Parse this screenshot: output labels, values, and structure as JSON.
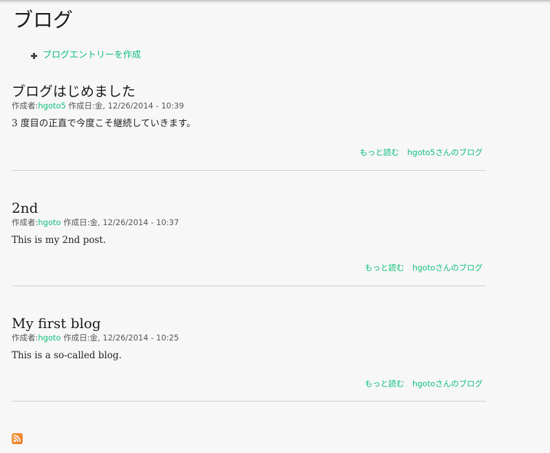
{
  "page": {
    "title": "ブログ"
  },
  "actions": {
    "create_entry": "ブログエントリーを作成"
  },
  "posts": [
    {
      "title": "ブログはじめました",
      "meta_prefix": "作成者:",
      "author": "hgoto5",
      "meta_date": " 作成日:金, 12/26/2014 - 10:39",
      "body": "3 度目の正直で今度こそ継続していきます。",
      "read_more": "もっと読む",
      "author_blog": "hgoto5さんのブログ"
    },
    {
      "title": "2nd",
      "meta_prefix": "作成者:",
      "author": "hgoto",
      "meta_date": " 作成日:金, 12/26/2014 - 10:37",
      "body": "This is my 2nd post.",
      "read_more": "もっと読む",
      "author_blog": "hgotoさんのブログ"
    },
    {
      "title": "My first blog",
      "meta_prefix": "作成者:",
      "author": "hgoto",
      "meta_date": " 作成日:金, 12/26/2014 - 10:25",
      "body": "This is a so-called blog.",
      "read_more": "もっと読む",
      "author_blog": "hgotoさんのブログ"
    }
  ],
  "footer": {
    "feed_icon": "rss-feed-icon"
  },
  "colors": {
    "link": "#0bbf7a",
    "background": "#f7f7f7",
    "feed": "#e8731b"
  }
}
